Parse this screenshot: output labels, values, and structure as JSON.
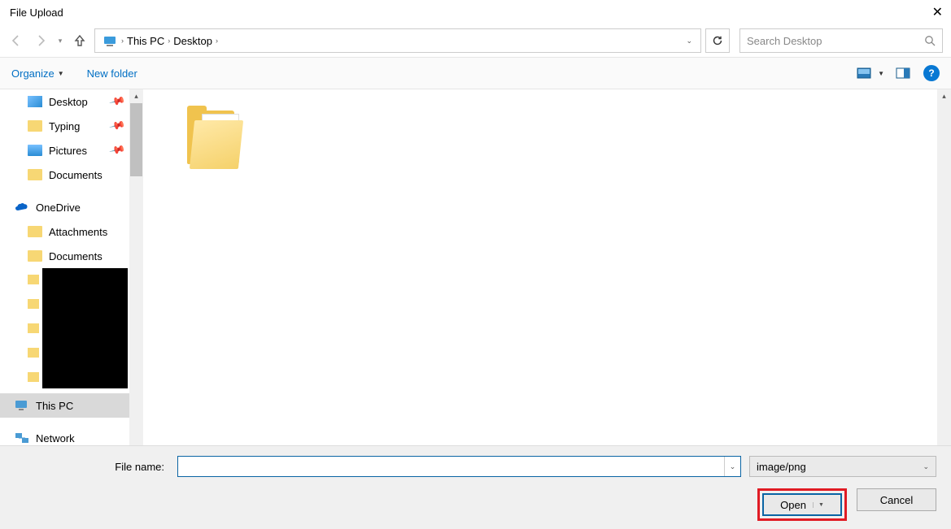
{
  "title": "File Upload",
  "breadcrumb": {
    "root": "This PC",
    "current": "Desktop"
  },
  "search": {
    "placeholder": "Search Desktop"
  },
  "toolbar": {
    "organize": "Organize",
    "newfolder": "New folder"
  },
  "tree": {
    "quick": [
      {
        "label": "Desktop",
        "pinned": true
      },
      {
        "label": "Typing",
        "pinned": true
      },
      {
        "label": "Pictures",
        "pinned": true
      },
      {
        "label": "Documents",
        "pinned": false
      }
    ],
    "onedrive": {
      "label": "OneDrive",
      "children": [
        "Attachments",
        "Documents"
      ]
    },
    "thispc": {
      "label": "This PC"
    },
    "network": {
      "label": "Network"
    }
  },
  "filename_label": "File name:",
  "filename_value": "",
  "filetype": "image/png",
  "buttons": {
    "open": "Open",
    "cancel": "Cancel"
  }
}
